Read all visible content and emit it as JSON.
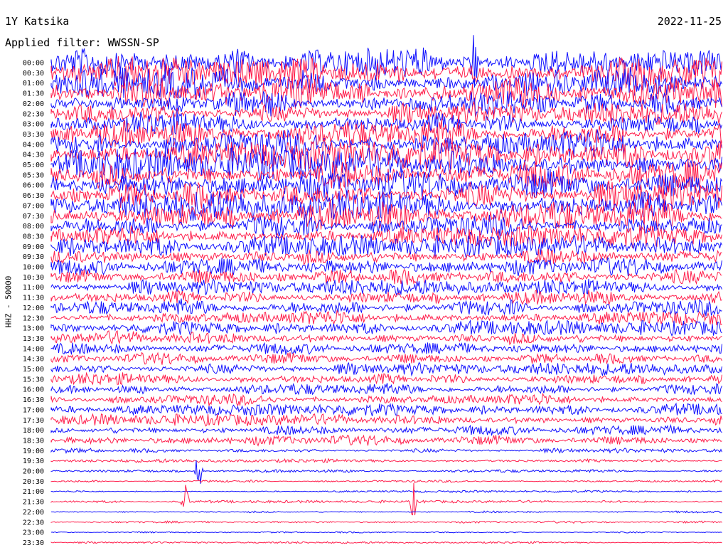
{
  "header": {
    "station": "1Y Katsika",
    "date": "2022-11-25",
    "filter": "Applied filter: WWSSN-SP"
  },
  "chart_data": {
    "type": "line",
    "title": "1Y Katsika",
    "ylabel": "HHZ - 50000",
    "colors": {
      "blue": "#1010ff",
      "red": "#ff1f4c"
    },
    "row_labels": [
      "00:00",
      "00:30",
      "01:00",
      "01:30",
      "02:00",
      "02:30",
      "03:00",
      "03:30",
      "04:00",
      "04:30",
      "05:00",
      "05:30",
      "06:00",
      "06:30",
      "07:00",
      "07:30",
      "08:00",
      "08:30",
      "09:00",
      "09:30",
      "10:00",
      "10:30",
      "11:00",
      "11:30",
      "12:00",
      "12:30",
      "13:00",
      "13:30",
      "14:00",
      "14:30",
      "15:00",
      "15:30",
      "16:00",
      "16:30",
      "17:00",
      "17:30",
      "18:00",
      "18:30",
      "19:00",
      "19:30",
      "20:00",
      "20:30",
      "21:00",
      "21:30",
      "22:00",
      "22:30",
      "23:00",
      "23:30"
    ],
    "row_colors": [
      "blue",
      "red",
      "blue",
      "red",
      "blue",
      "red",
      "blue",
      "red",
      "blue",
      "red",
      "blue",
      "red",
      "blue",
      "red",
      "blue",
      "red",
      "blue",
      "red",
      "blue",
      "red",
      "blue",
      "red",
      "blue",
      "red",
      "blue",
      "red",
      "blue",
      "red",
      "blue",
      "red",
      "blue",
      "red",
      "blue",
      "red",
      "blue",
      "red",
      "blue",
      "red",
      "blue",
      "red",
      "blue",
      "red",
      "blue",
      "red",
      "blue",
      "red",
      "blue",
      "red"
    ],
    "row_amplitudes": [
      0.9,
      1.0,
      1.0,
      1.0,
      0.8,
      0.7,
      0.8,
      0.9,
      1.0,
      1.0,
      1.0,
      1.0,
      1.0,
      1.0,
      1.0,
      1.0,
      0.8,
      0.7,
      0.65,
      0.6,
      0.6,
      0.6,
      0.5,
      0.5,
      0.55,
      0.5,
      0.45,
      0.45,
      0.4,
      0.4,
      0.4,
      0.4,
      0.38,
      0.38,
      0.38,
      0.36,
      0.34,
      0.34,
      0.15,
      0.12,
      0.1,
      0.08,
      0.07,
      0.08,
      0.07,
      0.07,
      0.06,
      0.06
    ],
    "events": [
      {
        "row": 0,
        "position": 0.63,
        "amplitude": 1.0
      },
      {
        "row": 40,
        "position": 0.22,
        "amplitude": 0.4
      },
      {
        "row": 43,
        "position": 0.2,
        "amplitude": 0.3
      },
      {
        "row": 43,
        "position": 0.54,
        "amplitude": 0.3
      }
    ],
    "grid": false
  }
}
